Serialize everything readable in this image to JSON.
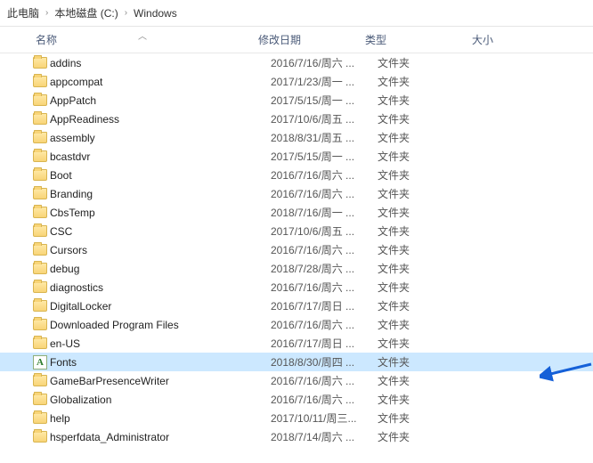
{
  "breadcrumb": {
    "part1": "此电脑",
    "part2": "本地磁盘 (C:)",
    "part3": "Windows"
  },
  "columns": {
    "name": "名称",
    "date": "修改日期",
    "type": "类型",
    "size": "大小"
  },
  "type_folder": "文件夹",
  "fonts_letter": "A",
  "items": [
    {
      "name": "addins",
      "date": "2016/7/16/周六 ...",
      "selected": false,
      "icon": "folder"
    },
    {
      "name": "appcompat",
      "date": "2017/1/23/周一 ...",
      "selected": false,
      "icon": "folder"
    },
    {
      "name": "AppPatch",
      "date": "2017/5/15/周一 ...",
      "selected": false,
      "icon": "folder"
    },
    {
      "name": "AppReadiness",
      "date": "2017/10/6/周五 ...",
      "selected": false,
      "icon": "folder"
    },
    {
      "name": "assembly",
      "date": "2018/8/31/周五 ...",
      "selected": false,
      "icon": "folder"
    },
    {
      "name": "bcastdvr",
      "date": "2017/5/15/周一 ...",
      "selected": false,
      "icon": "folder"
    },
    {
      "name": "Boot",
      "date": "2016/7/16/周六 ...",
      "selected": false,
      "icon": "folder"
    },
    {
      "name": "Branding",
      "date": "2016/7/16/周六 ...",
      "selected": false,
      "icon": "folder"
    },
    {
      "name": "CbsTemp",
      "date": "2018/7/16/周一 ...",
      "selected": false,
      "icon": "folder"
    },
    {
      "name": "CSC",
      "date": "2017/10/6/周五 ...",
      "selected": false,
      "icon": "folder"
    },
    {
      "name": "Cursors",
      "date": "2016/7/16/周六 ...",
      "selected": false,
      "icon": "folder"
    },
    {
      "name": "debug",
      "date": "2018/7/28/周六 ...",
      "selected": false,
      "icon": "folder"
    },
    {
      "name": "diagnostics",
      "date": "2016/7/16/周六 ...",
      "selected": false,
      "icon": "folder"
    },
    {
      "name": "DigitalLocker",
      "date": "2016/7/17/周日 ...",
      "selected": false,
      "icon": "folder"
    },
    {
      "name": "Downloaded Program Files",
      "date": "2016/7/16/周六 ...",
      "selected": false,
      "icon": "folder"
    },
    {
      "name": "en-US",
      "date": "2016/7/17/周日 ...",
      "selected": false,
      "icon": "folder"
    },
    {
      "name": "Fonts",
      "date": "2018/8/30/周四 ...",
      "selected": true,
      "icon": "fonts"
    },
    {
      "name": "GameBarPresenceWriter",
      "date": "2016/7/16/周六 ...",
      "selected": false,
      "icon": "folder"
    },
    {
      "name": "Globalization",
      "date": "2016/7/16/周六 ...",
      "selected": false,
      "icon": "folder"
    },
    {
      "name": "help",
      "date": "2017/10/11/周三...",
      "selected": false,
      "icon": "folder"
    },
    {
      "name": "hsperfdata_Administrator",
      "date": "2018/7/14/周六 ...",
      "selected": false,
      "icon": "folder"
    }
  ]
}
